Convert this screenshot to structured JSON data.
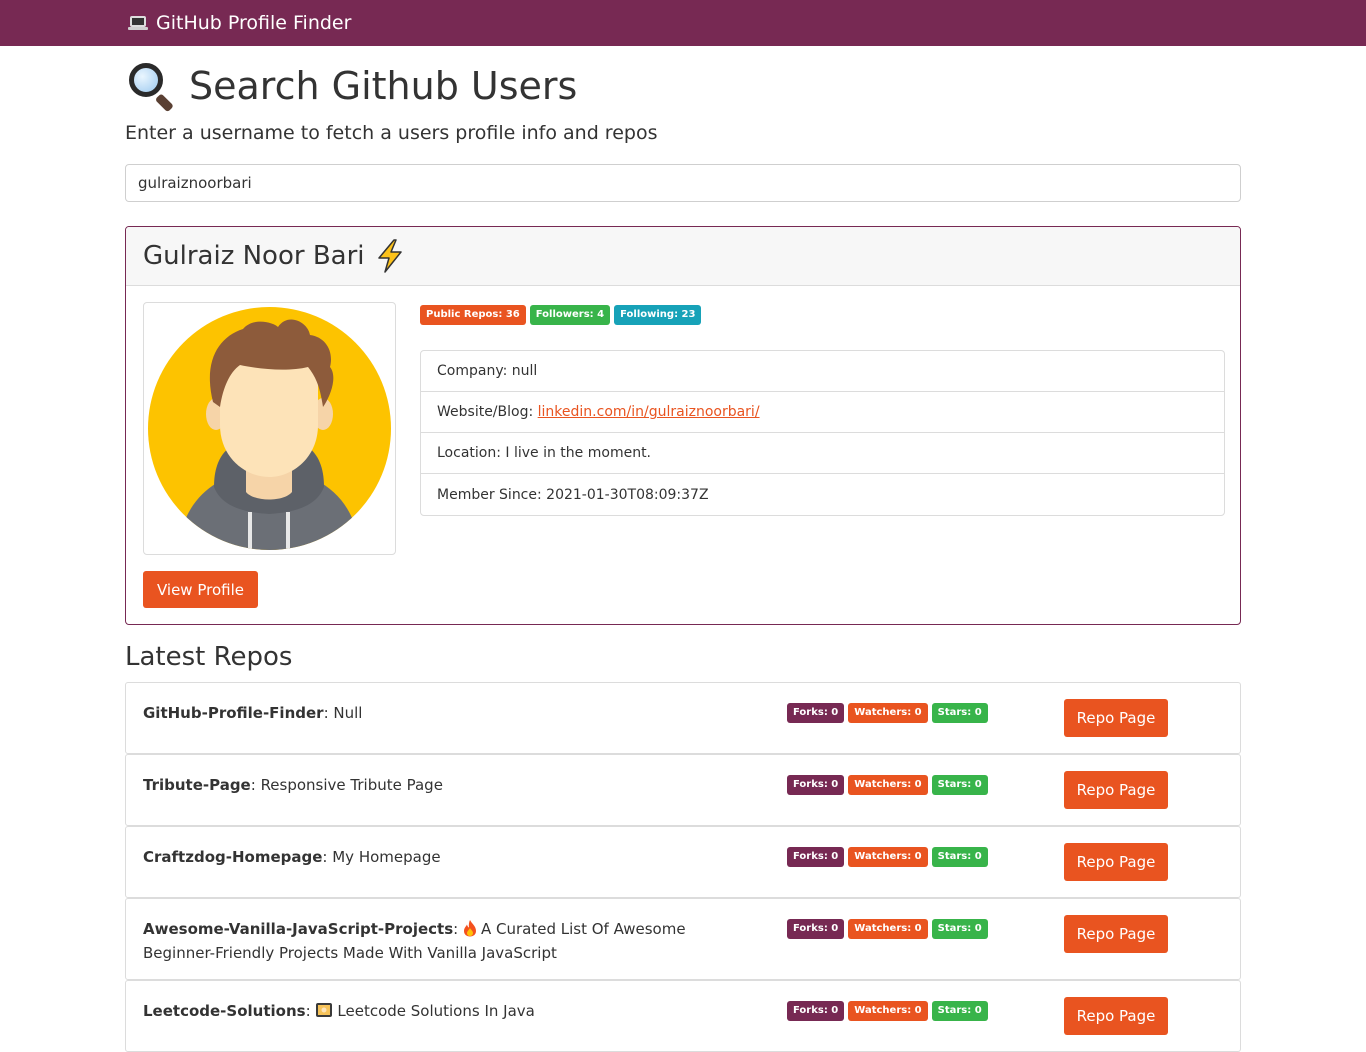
{
  "navbar": {
    "brand": "GitHub Profile Finder",
    "brand_icon": "laptop-icon"
  },
  "search": {
    "title": "Search Github Users",
    "title_icon": "magnifier-icon",
    "lead": "Enter a username to fetch a users profile info and repos",
    "value": "gulraiznoorbari"
  },
  "profile": {
    "name": "Gulraiz Noor Bari",
    "name_icon": "lightning-icon",
    "badges": [
      {
        "label": "Public Repos: 36",
        "color": "#e95420"
      },
      {
        "label": "Followers: 4",
        "color": "#38b44a"
      },
      {
        "label": "Following: 23",
        "color": "#17a2b8"
      }
    ],
    "company_label": "Company:",
    "company": "null",
    "website_label": "Website/Blog:",
    "website": "linkedin.com/in/gulraiznoorbari/",
    "location_label": "Location:",
    "location": "I live in the moment.",
    "member_since_label": "Member Since:",
    "member_since": "2021-01-30T08:09:37Z",
    "view_profile_label": "View Profile"
  },
  "repos": {
    "heading": "Latest Repos",
    "button_label": "Repo Page",
    "items": [
      {
        "name": "GitHub-Profile-Finder",
        "description": "Null",
        "forks": "Forks: 0",
        "watchers": "Watchers: 0",
        "stars": "Stars: 0"
      },
      {
        "name": "Tribute-Page",
        "description": "Responsive Tribute Page",
        "forks": "Forks: 0",
        "watchers": "Watchers: 0",
        "stars": "Stars: 0"
      },
      {
        "name": "Craftzdog-Homepage",
        "description": "My Homepage",
        "forks": "Forks: 0",
        "watchers": "Watchers: 0",
        "stars": "Stars: 0"
      },
      {
        "name": "Awesome-Vanilla-JavaScript-Projects",
        "description": "A Curated List Of Awesome Beginner-Friendly Projects Made With Vanilla JavaScript",
        "desc_icon": "fire-icon",
        "forks": "Forks: 0",
        "watchers": "Watchers: 0",
        "stars": "Stars: 0"
      },
      {
        "name": "Leetcode-Solutions",
        "description": "Leetcode Solutions In Java",
        "desc_icon": "code-icon",
        "forks": "Forks: 0",
        "watchers": "Watchers: 0",
        "stars": "Stars: 0"
      }
    ]
  },
  "colors": {
    "navbar": "#772953",
    "accent": "#e95420",
    "success": "#38b44a",
    "info": "#17a2b8"
  }
}
